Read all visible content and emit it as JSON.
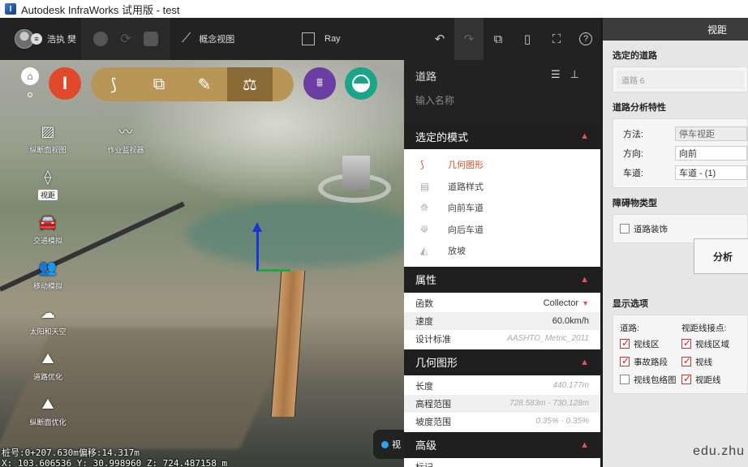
{
  "window": {
    "title": "Autodesk InfraWorks 试用版 - test"
  },
  "toolbar": {
    "user_name": "浩执 樊",
    "concept_label": "概念视图",
    "ray_label": "Ray"
  },
  "viewport": {
    "left_tools": [
      {
        "label": "纵断面视图"
      },
      {
        "label": "作业监视器"
      },
      {
        "label": "视距"
      },
      {
        "label": "交通模拟"
      },
      {
        "label": "移动模拟"
      },
      {
        "label": "太阳和天空"
      },
      {
        "label": "道路优化"
      },
      {
        "label": "纵断面优化"
      }
    ],
    "status_line1": "桩号:0+207.630m偏移:14.317m",
    "status_line2": "X: 103.606536 Y: 30.998960 Z: 724.487158 m",
    "chip_label": "视"
  },
  "roads_panel": {
    "title": "道路",
    "name_placeholder": "输入名称",
    "mode_section": "选定的模式",
    "modes": [
      {
        "label": "几何图形"
      },
      {
        "label": "道路样式"
      },
      {
        "label": "向前车道"
      },
      {
        "label": "向后车道"
      },
      {
        "label": "放坡"
      }
    ],
    "props_section": "属性",
    "props": [
      {
        "key": "函数",
        "value": "Collector"
      },
      {
        "key": "速度",
        "value": "60.0km/h"
      },
      {
        "key": "设计标准",
        "value": "AASHTO_Metric_2011"
      }
    ],
    "geom_section": "几何图形",
    "geom": [
      {
        "key": "长度",
        "value": "440.177m"
      },
      {
        "key": "高程范围",
        "value": "728.583m - 730.128m"
      },
      {
        "key": "坡度范围",
        "value": "0.35% - 0.35%"
      }
    ],
    "adv_section": "高级",
    "adv_first": "标记"
  },
  "sight_panel": {
    "title": "视距",
    "selected_road_label": "选定的道路",
    "selected_road_value": "道路 6",
    "analysis_label": "道路分析特性",
    "method_key": "方法:",
    "method_value": "停车视距",
    "direction_key": "方向:",
    "direction_value": "向前",
    "lane_key": "车道:",
    "lane_value": "车道 - (1)",
    "obstacle_label": "障碍物类型",
    "obstacle_item": "道路装饰",
    "analyze_button": "分析",
    "display_label": "显示选项",
    "col1_head": "道路:",
    "col2_head": "视距线接点:",
    "col1_items": [
      {
        "label": "视线区"
      },
      {
        "label": "事故路段"
      },
      {
        "label": "视线包络图"
      }
    ],
    "col2_items": [
      {
        "label": "视线区域"
      },
      {
        "label": "视线"
      },
      {
        "label": "视距线"
      }
    ],
    "watermark": "edu.zhu"
  },
  "colors": {
    "accent_red": "#e04a2a",
    "tool_gold": "#b89657",
    "purple": "#6b3ea2",
    "teal": "#1aa58a"
  }
}
